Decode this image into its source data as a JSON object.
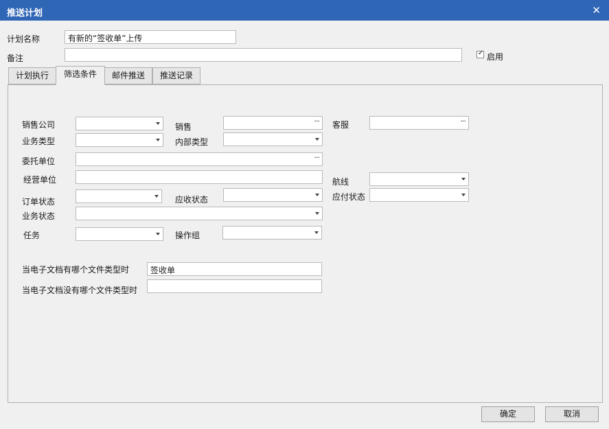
{
  "window": {
    "title": "推送计划",
    "close": "✕"
  },
  "plan": {
    "name_label": "计划名称",
    "name_value": "有新的“签收单”上传",
    "remark_label": "备注",
    "remark_value": "",
    "enabled_label": "启用",
    "enabled_checked": true
  },
  "tabs": [
    {
      "label": "计划执行",
      "active": false
    },
    {
      "label": "筛选条件",
      "active": true
    },
    {
      "label": "邮件推送",
      "active": false
    },
    {
      "label": "推送记录",
      "active": false
    }
  ],
  "filters": {
    "sales_company": {
      "label": "销售公司",
      "value": ""
    },
    "sales": {
      "label": "销售",
      "value": ""
    },
    "customer_service": {
      "label": "客服",
      "value": ""
    },
    "business_type": {
      "label": "业务类型",
      "value": ""
    },
    "internal_type": {
      "label": "内部类型",
      "value": ""
    },
    "consignor": {
      "label": "委托单位",
      "value": ""
    },
    "operator_unit": {
      "label": "经营单位",
      "value": ""
    },
    "route": {
      "label": "航线",
      "value": ""
    },
    "order_status": {
      "label": "订单状态",
      "value": ""
    },
    "receivable_status": {
      "label": "应收状态",
      "value": ""
    },
    "payable_status": {
      "label": "应付状态",
      "value": ""
    },
    "business_status": {
      "label": "业务状态",
      "value": ""
    },
    "task": {
      "label": "任务",
      "value": ""
    },
    "operation_group": {
      "label": "操作组",
      "value": ""
    },
    "doc_has_type": {
      "label": "当电子文档有哪个文件类型时",
      "value": "签收单"
    },
    "doc_missing_type": {
      "label": "当电子文档没有哪个文件类型时",
      "value": ""
    }
  },
  "icons": {
    "ellipsis": "···",
    "dropdown": "chevron-down-icon"
  },
  "buttons": {
    "ok": "确定",
    "cancel": "取消"
  },
  "colors": {
    "titlebar": "#2f66b5"
  }
}
